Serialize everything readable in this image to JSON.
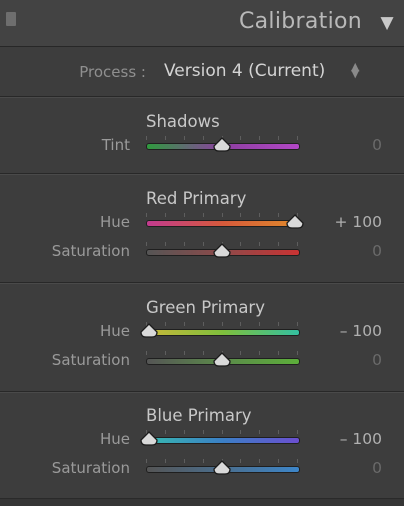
{
  "panel": {
    "title": "Calibration",
    "toggle_glyph": "▼"
  },
  "process": {
    "label": "Process :",
    "value": "Version 4 (Current)",
    "stepper_glyph": "⬍"
  },
  "sections": [
    {
      "title": "Shadows",
      "sliders": [
        {
          "label": "Tint",
          "value_text": "0",
          "position": 0.5,
          "gradient": [
            "#2f9a3e",
            "#8d3fa1",
            "#b247c6"
          ]
        }
      ]
    },
    {
      "title": "Red Primary",
      "sliders": [
        {
          "label": "Hue",
          "value_text": "+ 100",
          "position": 0.98,
          "gradient": [
            "#c23b8f",
            "#d65a3b",
            "#e08a2b"
          ]
        },
        {
          "label": "Saturation",
          "value_text": "0",
          "position": 0.5,
          "gradient": [
            "#555555",
            "#8e4a4a",
            "#c93333"
          ]
        }
      ]
    },
    {
      "title": "Green Primary",
      "sliders": [
        {
          "label": "Hue",
          "value_text": "– 100",
          "position": 0.02,
          "gradient": [
            "#c8b83a",
            "#7fbf3c",
            "#34bfa0"
          ]
        },
        {
          "label": "Saturation",
          "value_text": "0",
          "position": 0.5,
          "gradient": [
            "#555555",
            "#5b8a4a",
            "#5cae3a"
          ]
        }
      ]
    },
    {
      "title": "Blue Primary",
      "sliders": [
        {
          "label": "Hue",
          "value_text": "– 100",
          "position": 0.02,
          "gradient": [
            "#37b9b0",
            "#3b7fc6",
            "#6b4fd0"
          ]
        },
        {
          "label": "Saturation",
          "value_text": "0",
          "position": 0.5,
          "gradient": [
            "#555555",
            "#4a6e8e",
            "#3d86c9"
          ]
        }
      ]
    }
  ],
  "icons": {
    "collapse": "collapse-square-icon",
    "toggle": "triangle-down-icon",
    "stepper": "up-down-stepper-icon",
    "thumb": "slider-thumb-icon"
  }
}
